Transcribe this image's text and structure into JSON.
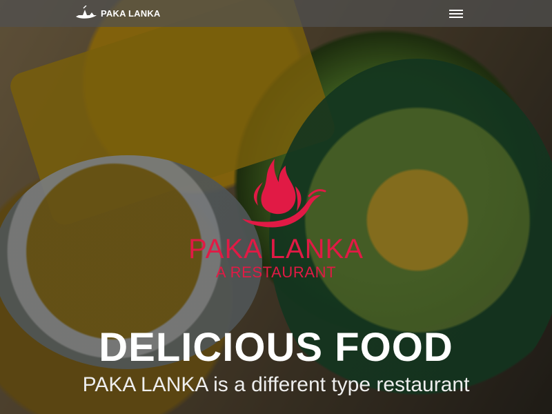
{
  "nav": {
    "logo_text": "PAKA LANKA",
    "logo_icon": "ship-logo-icon",
    "menu_icon": "hamburger-menu-icon"
  },
  "hero": {
    "brand_name": "PAKA LANKA",
    "brand_subtitle": "A RESTAURANT",
    "brand_icon": "flame-chili-logo-icon",
    "headline": "DELICIOUS FOOD",
    "subheadline": "PAKA LANKA is a different type restaurant"
  },
  "colors": {
    "accent": "#e11a45",
    "white": "#ffffff",
    "nav_bar": "#505050"
  }
}
